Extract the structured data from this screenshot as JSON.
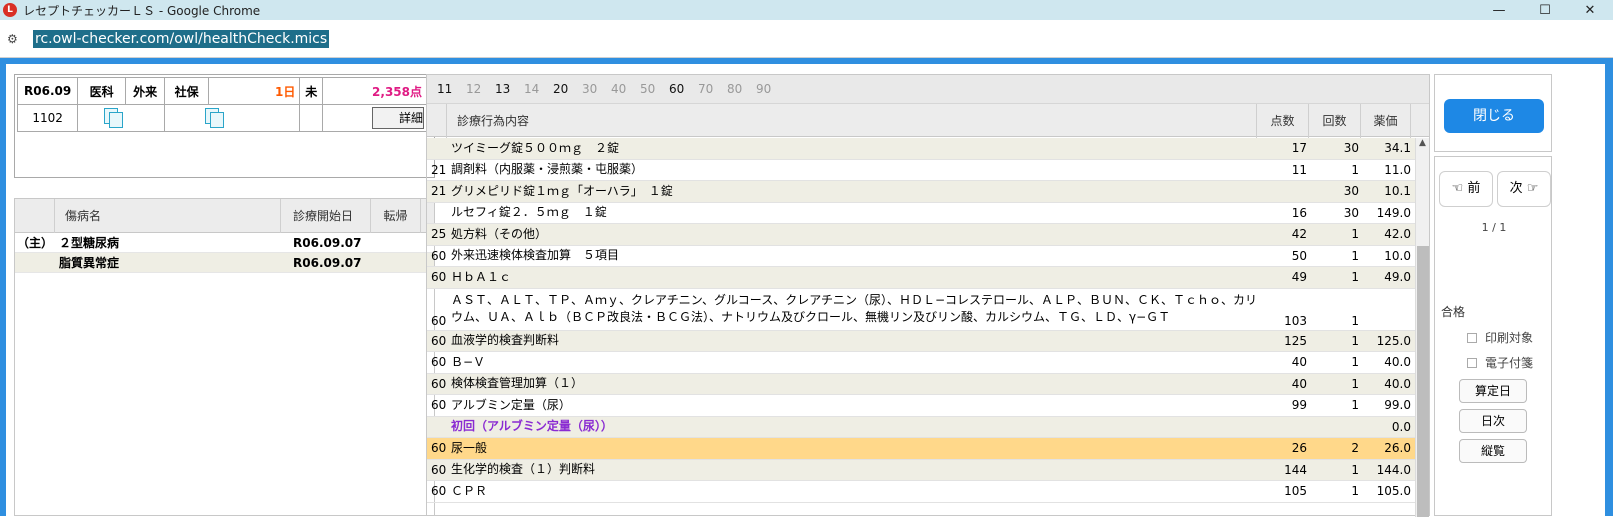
{
  "window": {
    "title": "レセプトチェッカーＬＳ - Google Chrome",
    "minimize": "—",
    "maximize": "☐",
    "close": "✕"
  },
  "address": {
    "url": "rc.owl-checker.com/owl/healthCheck.mics"
  },
  "header": {
    "era_month": "R06.09",
    "type1": "医科",
    "type2": "外来",
    "insurer": "社保",
    "days": "1日",
    "status": "未",
    "points": "2,358点",
    "code": "1102",
    "detail_label": "詳細"
  },
  "disease": {
    "columns": [
      "",
      "傷病名",
      "診療開始日",
      "転帰"
    ],
    "rows": [
      {
        "main": "（主）",
        "name": "２型糖尿病",
        "start": "R06.09.07",
        "outcome": ""
      },
      {
        "main": "",
        "name": "脂質異常症",
        "start": "R06.09.07",
        "outcome": ""
      }
    ]
  },
  "tabs": [
    {
      "label": "11",
      "active": true
    },
    {
      "label": "12",
      "active": false
    },
    {
      "label": "13",
      "active": true
    },
    {
      "label": "14",
      "active": false
    },
    {
      "label": "20",
      "active": true
    },
    {
      "label": "30",
      "active": false
    },
    {
      "label": "40",
      "active": false
    },
    {
      "label": "50",
      "active": false
    },
    {
      "label": "60",
      "active": true
    },
    {
      "label": "70",
      "active": false
    },
    {
      "label": "80",
      "active": false
    },
    {
      "label": "90",
      "active": false
    }
  ],
  "main": {
    "columns": [
      "",
      "診療行為内容",
      "点数",
      "回数",
      "薬価"
    ],
    "rows": [
      {
        "code": "",
        "text": "ツイミーグ錠５００ｍｇ　２錠",
        "points": "17",
        "count": "30",
        "price": "34.1"
      },
      {
        "code": "21",
        "text": "調剤料（内服薬・浸煎薬・屯服薬）",
        "points": "11",
        "count": "1",
        "price": "11.0"
      },
      {
        "code": "21",
        "text": "グリメピリド錠１ｍｇ「オーハラ」　１錠",
        "points": "",
        "count": "30",
        "price": "10.1"
      },
      {
        "code": "",
        "text": "ルセフィ錠２．５ｍｇ　１錠",
        "points": "16",
        "count": "30",
        "price": "149.0"
      },
      {
        "code": "25",
        "text": "処方料（その他）",
        "points": "42",
        "count": "1",
        "price": "42.0"
      },
      {
        "code": "60",
        "text": "外来迅速検体検査加算　５項目",
        "points": "50",
        "count": "1",
        "price": "10.0"
      },
      {
        "code": "60",
        "text": "ＨｂＡ１ｃ",
        "points": "49",
        "count": "1",
        "price": "49.0"
      },
      {
        "code": "60",
        "text": "ＡＳＴ、ＡＬＴ、ＴＰ、Ａｍｙ、クレアチニン、グルコース、クレアチニン（尿）、ＨＤＬ−コレステロール、ＡＬＰ、ＢＵＮ、ＣＫ、Ｔｃｈｏ、カリウム、ＵＡ、Ａｌｂ（ＢＣＰ改良法・ＢＣＧ法）、ナトリウム及びクロール、無機リン及びリン酸、カルシウム、ＴＧ、ＬＤ、γ−ＧＴ",
        "points": "103",
        "count": "1",
        "price": ""
      },
      {
        "code": "60",
        "text": "血液学的検査判断料",
        "points": "125",
        "count": "1",
        "price": "125.0"
      },
      {
        "code": "60",
        "text": "Ｂ−Ｖ",
        "points": "40",
        "count": "1",
        "price": "40.0"
      },
      {
        "code": "60",
        "text": "検体検査管理加算（１）",
        "points": "40",
        "count": "1",
        "price": "40.0"
      },
      {
        "code": "60",
        "text": "アルブミン定量（尿）",
        "points": "99",
        "count": "1",
        "price": "99.0"
      },
      {
        "code": "",
        "text": "初回（アルブミン定量（尿））",
        "points": "",
        "count": "",
        "price": "0.0"
      },
      {
        "code": "60",
        "text": "尿一般",
        "points": "26",
        "count": "2",
        "price": "26.0"
      },
      {
        "code": "60",
        "text": "生化学的検査（１）判断料",
        "points": "144",
        "count": "1",
        "price": "144.0"
      },
      {
        "code": "60",
        "text": "ＣＰＲ",
        "points": "105",
        "count": "1",
        "price": "105.0"
      }
    ]
  },
  "side": {
    "close_label": "閉じる",
    "prev_label": "前",
    "next_label": "次",
    "page": "1 / 1",
    "pass_label": "合格",
    "print_label": "印刷対象",
    "ereceipt_label": "電子付箋",
    "calc_day_label": "算定日",
    "daily_label": "日次",
    "vertical_label": "縦覧"
  },
  "colors": {
    "accent": "#1e88e5",
    "points_pink": "#e01b84",
    "days_orange": "#ff5a00",
    "selected_row": "#ffd88a",
    "purple_text": "#8a2bd2"
  }
}
